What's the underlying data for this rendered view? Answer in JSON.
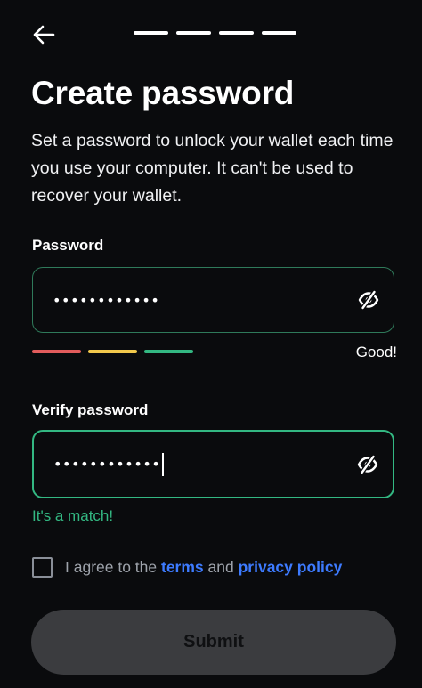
{
  "header": {
    "back_icon": "arrow-left-icon",
    "progress_steps": 4
  },
  "title": "Create password",
  "description": "Set a password to unlock your wallet each time you use your computer. It can't be used to recover your wallet.",
  "password": {
    "label": "Password",
    "value": "••••••••••••",
    "toggle_icon": "eye-off-icon",
    "strength_colors": [
      "#e25c5c",
      "#f2c94c",
      "#33b882"
    ],
    "strength_label": "Good!"
  },
  "verify": {
    "label": "Verify password",
    "value": "••••••••••••",
    "toggle_icon": "eye-off-icon",
    "match_text": "It's a match!"
  },
  "agreement": {
    "prefix": "I agree to the ",
    "terms": "terms",
    "middle": " and ",
    "privacy": "privacy policy"
  },
  "submit_label": "Submit",
  "colors": {
    "background": "#0a0b0d",
    "accent_green": "#33b882",
    "link_blue": "#3d7bff",
    "button_disabled": "#3b3c3f"
  }
}
